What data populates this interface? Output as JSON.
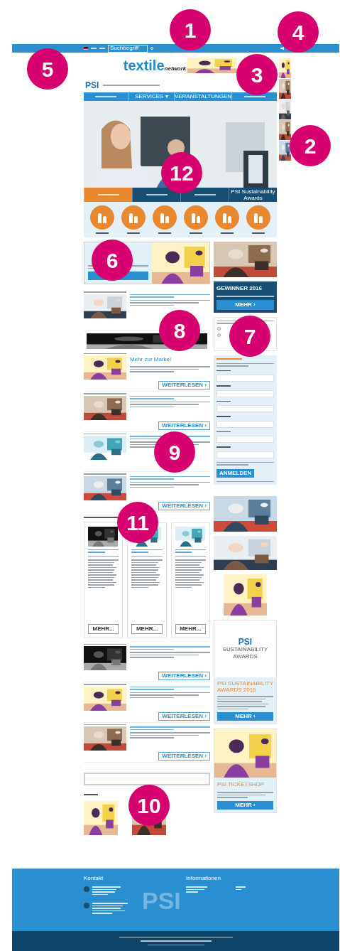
{
  "markers": [
    "1",
    "2",
    "3",
    "4",
    "5",
    "6",
    "7",
    "8",
    "9",
    "10",
    "11",
    "12"
  ],
  "top_bar": {
    "search": {
      "placeholder": "Suchbegriff"
    }
  },
  "header": {
    "logo": "textile",
    "logo_sub": "network",
    "brand": "PSI"
  },
  "nav": [
    {
      "kind": "illegible"
    },
    {
      "kind": "text",
      "label": "SERVICES ▾"
    },
    {
      "kind": "text",
      "label": "VERANSTALTUNGEN"
    },
    {
      "kind": "illegible"
    }
  ],
  "hero_tabs": [
    {
      "selected": true
    },
    {
      "selected": false
    },
    {
      "selected": false
    },
    {
      "selected": false,
      "label": "PSI Sustainability Awards"
    }
  ],
  "articles": [
    {
      "kind": "text"
    },
    {
      "kind": "banner"
    },
    {
      "kind": "text",
      "title": "Mehr zur Marke!",
      "button": "WEITERLESEN ›"
    },
    {
      "kind": "text",
      "button": "WEITERLESEN ›"
    },
    {
      "kind": "text"
    },
    {
      "kind": "text",
      "button": "WEITERLESEN ›"
    },
    {
      "kind": "products",
      "cards": [
        {
          "button": "MEHR..."
        },
        {
          "button": "MEHR..."
        },
        {
          "button": "MEHR..."
        }
      ]
    },
    {
      "kind": "text",
      "button": "WEITERLESEN ›"
    },
    {
      "kind": "text",
      "button": "WEITERLESEN ›"
    },
    {
      "kind": "text",
      "button": "WEITERLESEN ›"
    }
  ],
  "sidebar": {
    "winner": {
      "title": "GEWINNER 2016",
      "button": "MEHR ›"
    },
    "poll": {
      "options": [
        {
          "selected": false
        },
        {
          "selected": false
        }
      ]
    },
    "newsletter": {
      "button": "ANMELDEN"
    },
    "awards": {
      "logo_brand": "PSI",
      "logo_line1": "SUSTAINABILITY",
      "logo_line2": "AWARDS",
      "title": "PSI SUSTAINABILITY AWARDS 2016",
      "button": "MEHR ›"
    },
    "ticketshop": {
      "title": "PSI TICKETSHOP",
      "button": "MEHR ›"
    }
  },
  "footer": {
    "contact_heading": "Kontakt",
    "info_heading": "Informationen",
    "watermark": "PSI"
  }
}
